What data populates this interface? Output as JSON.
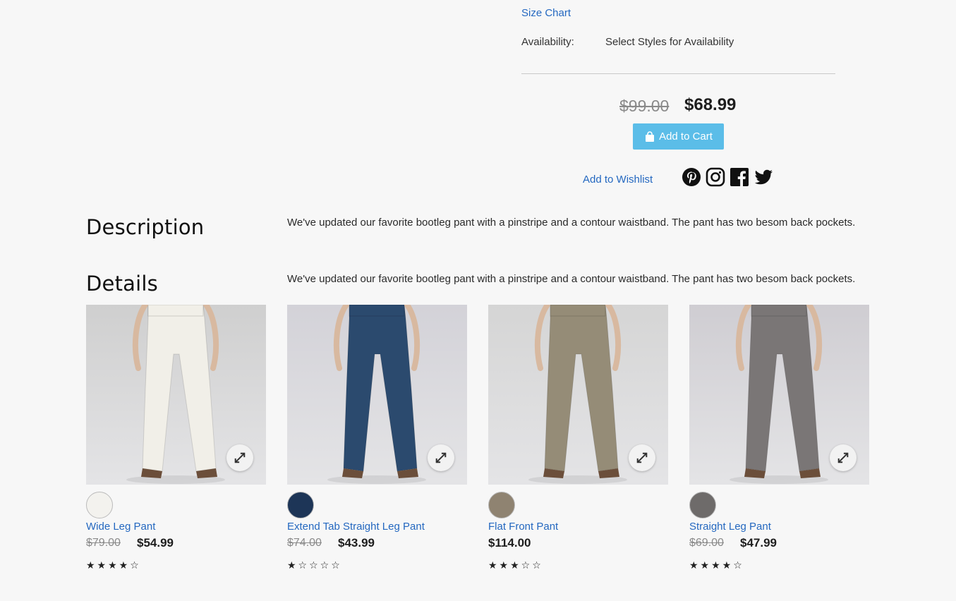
{
  "product": {
    "size_chart": "Size Chart",
    "availability_label": "Availability:",
    "availability_value": "Select Styles for Availability",
    "old_price": "$99.00",
    "new_price": "$68.99",
    "add_to_cart": "Add to Cart",
    "add_to_wishlist": "Add to Wishlist",
    "social_icons": [
      "pinterest-icon",
      "instagram-icon",
      "facebook-icon",
      "twitter-icon"
    ]
  },
  "sections": {
    "description_title": "Description",
    "description_text": "We've updated our favorite bootleg pant with a pinstripe and a contour waistband. The pant has two besom back pockets.",
    "details_title": "Details",
    "details_text": "We've updated our favorite bootleg pant with a pinstripe and a contour waistband. The pant has two besom back pockets."
  },
  "related": [
    {
      "name": "Wide Leg Pant",
      "old_price": "$79.00",
      "price": "$54.99",
      "rating": 4,
      "swatch_color": "#f3f2ee",
      "pant_color": "#f1efe8"
    },
    {
      "name": "Extend Tab Straight Leg Pant",
      "old_price": "$74.00",
      "price": "$43.99",
      "rating": 1,
      "swatch_color": "#1d3557",
      "pant_color": "#2b4a6e"
    },
    {
      "name": "Flat Front Pant",
      "old_price": "",
      "price": "$114.00",
      "rating": 3,
      "swatch_color": "#8f8371",
      "pant_color": "#958c77"
    },
    {
      "name": "Straight Leg Pant",
      "old_price": "$69.00",
      "price": "$47.99",
      "rating": 4,
      "swatch_color": "#6e6b6a",
      "pant_color": "#7a7676"
    }
  ],
  "colors": {
    "link": "#2468c0",
    "add_to_cart_bg": "#5bbde8",
    "background": "#f7f7f7"
  }
}
